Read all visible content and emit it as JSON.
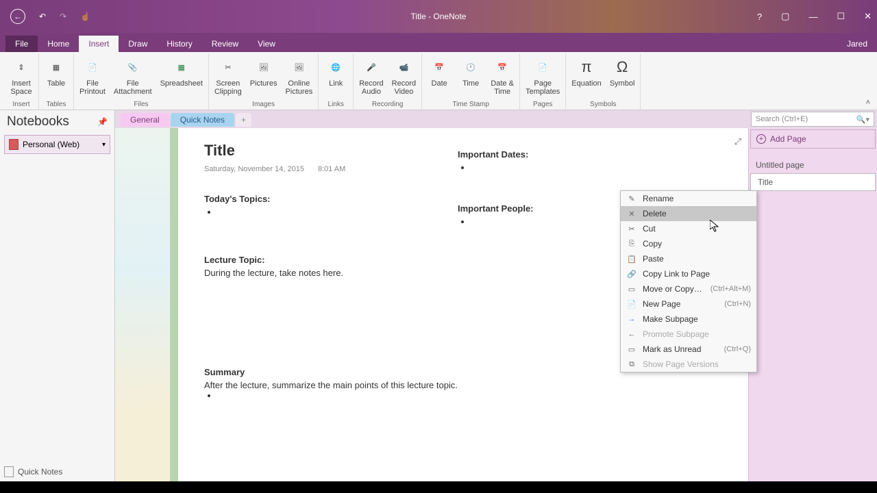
{
  "titlebar": {
    "title": "Title - OneNote"
  },
  "ribbonTabs": {
    "file": "File",
    "home": "Home",
    "insert": "Insert",
    "draw": "Draw",
    "history": "History",
    "review": "Review",
    "view": "View",
    "user": "Jared"
  },
  "ribbon": {
    "insertSpace": "Insert\nSpace",
    "table": "Table",
    "filePrintout": "File\nPrintout",
    "fileAttachment": "File\nAttachment",
    "spreadsheet": "Spreadsheet",
    "screenClipping": "Screen\nClipping",
    "pictures": "Pictures",
    "onlinePictures": "Online\nPictures",
    "link": "Link",
    "recordAudio": "Record\nAudio",
    "recordVideo": "Record\nVideo",
    "date": "Date",
    "time": "Time",
    "dateTime": "Date &\nTime",
    "pageTemplates": "Page\nTemplates",
    "equation": "Equation",
    "symbol": "Symbol",
    "groups": {
      "insert": "Insert",
      "tables": "Tables",
      "files": "Files",
      "images": "Images",
      "links": "Links",
      "recording": "Recording",
      "timestamp": "Time Stamp",
      "pages": "Pages",
      "symbols": "Symbols"
    }
  },
  "notebooks": {
    "header": "Notebooks",
    "personal": "Personal (Web)",
    "quickNotes": "Quick Notes"
  },
  "sectionTabs": {
    "general": "General",
    "quickNotes": "Quick Notes",
    "add": "+"
  },
  "search": {
    "placeholder": "Search (Ctrl+E)"
  },
  "pagePanel": {
    "addPage": "Add Page",
    "untitled": "Untitled page",
    "titlePage": "Title"
  },
  "page": {
    "title": "Title",
    "date": "Saturday, November 14, 2015",
    "time": "8:01 AM",
    "todaysTopics": "Today's Topics:",
    "importantDates": "Important Dates:",
    "importantPeople": "Important People:",
    "lectureTopic": "Lecture Topic:",
    "lectureNote": "During the lecture, take notes here.",
    "summary": "Summary",
    "summaryNote": "After the lecture, summarize the main points of this lecture topic."
  },
  "contextMenu": {
    "rename": "Rename",
    "delete": "Delete",
    "cut": "Cut",
    "copy": "Copy",
    "paste": "Paste",
    "copyLink": "Copy Link to Page",
    "moveCopy": "Move or Copy…",
    "moveCopyShortcut": "(Ctrl+Alt+M)",
    "newPage": "New Page",
    "newPageShortcut": "(Ctrl+N)",
    "makeSubpage": "Make Subpage",
    "promoteSubpage": "Promote Subpage",
    "markUnread": "Mark as Unread",
    "markUnreadShortcut": "(Ctrl+Q)",
    "showVersions": "Show Page Versions"
  }
}
